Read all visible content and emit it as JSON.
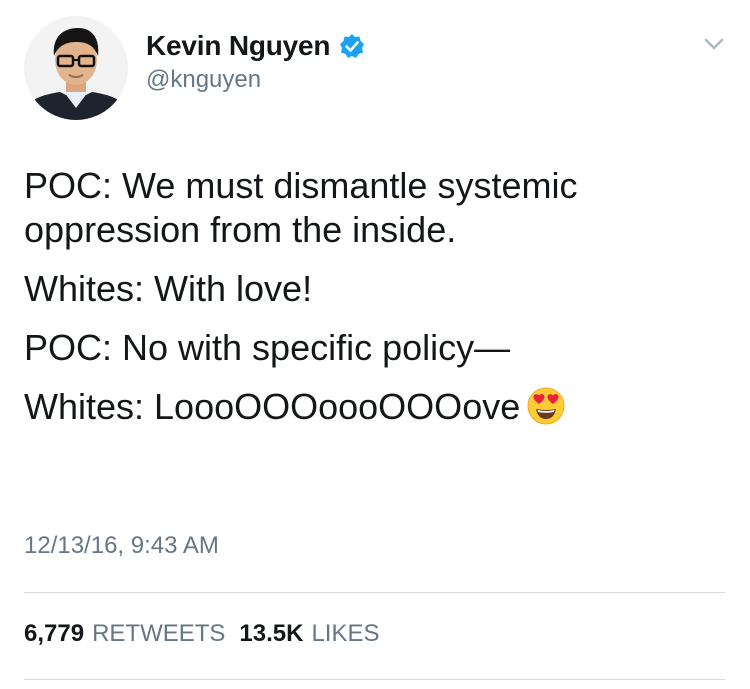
{
  "author": {
    "name": "Kevin Nguyen",
    "handle": "@knguyen",
    "verified": true,
    "avatar_icon": "profile-photo"
  },
  "tweet": {
    "lines": [
      "POC: We must dismantle systemic oppression from the inside.",
      "Whites: With love!",
      "POC: No with specific policy—",
      "Whites: LoooOOOoooOOOove"
    ],
    "trailing_emoji": "heart-eyes-emoji",
    "timestamp": "12/13/16, 9:43 AM"
  },
  "stats": {
    "retweets_count": "6,779",
    "retweets_label": "RETWEETS",
    "likes_count": "13.5K",
    "likes_label": "LIKES"
  },
  "colors": {
    "text": "#14171a",
    "secondary": "#657786",
    "verified": "#1da1f2",
    "divider": "#d6dbdf"
  }
}
